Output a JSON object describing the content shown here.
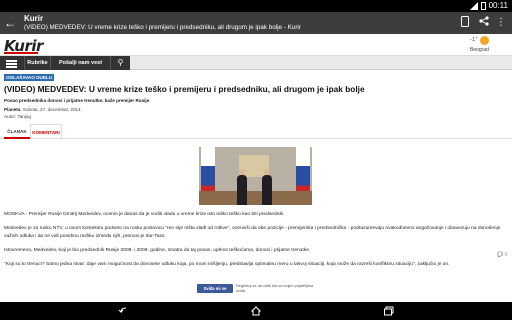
{
  "status": {
    "time": "00:11"
  },
  "appbar": {
    "title": "Kurir",
    "subtitle": "(VIDEO) MEDVEDEV: U vreme krize teško i premijeru i predsedniku, ali drugom je ipak bolje - Kurir"
  },
  "site": {
    "logo": "Kurir",
    "weather": {
      "temp": "-1°",
      "city": "Beograd"
    }
  },
  "nav": {
    "items": [
      "Rubrike",
      "Pošalji nam vest"
    ]
  },
  "article": {
    "tag": "OGLAŠAVAO DUELU",
    "headline": "(VIDEO) MEDVEDEV: U vreme krize teško i premijeru i predsedniku, ali drugom je ipak bolje",
    "lead": "Posao predsednika donosi i prijatne trenutke, kaže premijer Rusije",
    "section": "Planeta",
    "date": ", Subota, 27. decembar, 2014.",
    "author": "Autor: Tanjug",
    "tabs": [
      "ČLANAK",
      "KOMENTARI"
    ],
    "comment_count": "0",
    "paragraphs": [
      "MOSKVA - Premijer Rusije Dmitrij Medvedev, ocenio je danas da je voditi vladu u vreme krize isto toliko teško kao biti predsednik.",
      "Medvedev je za rusku NTV, u ovom kontekstu podseto na rusku poslovicu \"ren nije ništa slađi od rotkve\", ocenivši da obe pozicije - premijerska i predsednička - podrazumevaju ovakodnevno angažovanje i obavezuju na donošenje važnih odluka i da ne vidi posebnu razliku između njih, prenosi je Itar-Tass.",
      "Istovremeno, Medvedev, koji je bio predsednik Rusije 2008. i 2009. godine, smatra da taj posao, uprkos teškoćama, donosi i prijatne trenutke.",
      "\"Koji su to trenuci? Samo jedna stvar: daje vam mogućnost da donosete odluku koja, po mom mišljenju, predstavlja optimalnu meru u takvoj situaciji, koja može da razreši konfliktnu situaciju\", zaključio je on."
    ]
  },
  "facebook": {
    "button": "Sviđa mi se",
    "text": "Registruj se da vidiš šta se tvojim prijateljima sviđa."
  },
  "colors": {
    "appbar": "#3d3d3d",
    "accent": "#c00000",
    "tag": "#2b6cb0",
    "facebook": "#3b5998"
  }
}
